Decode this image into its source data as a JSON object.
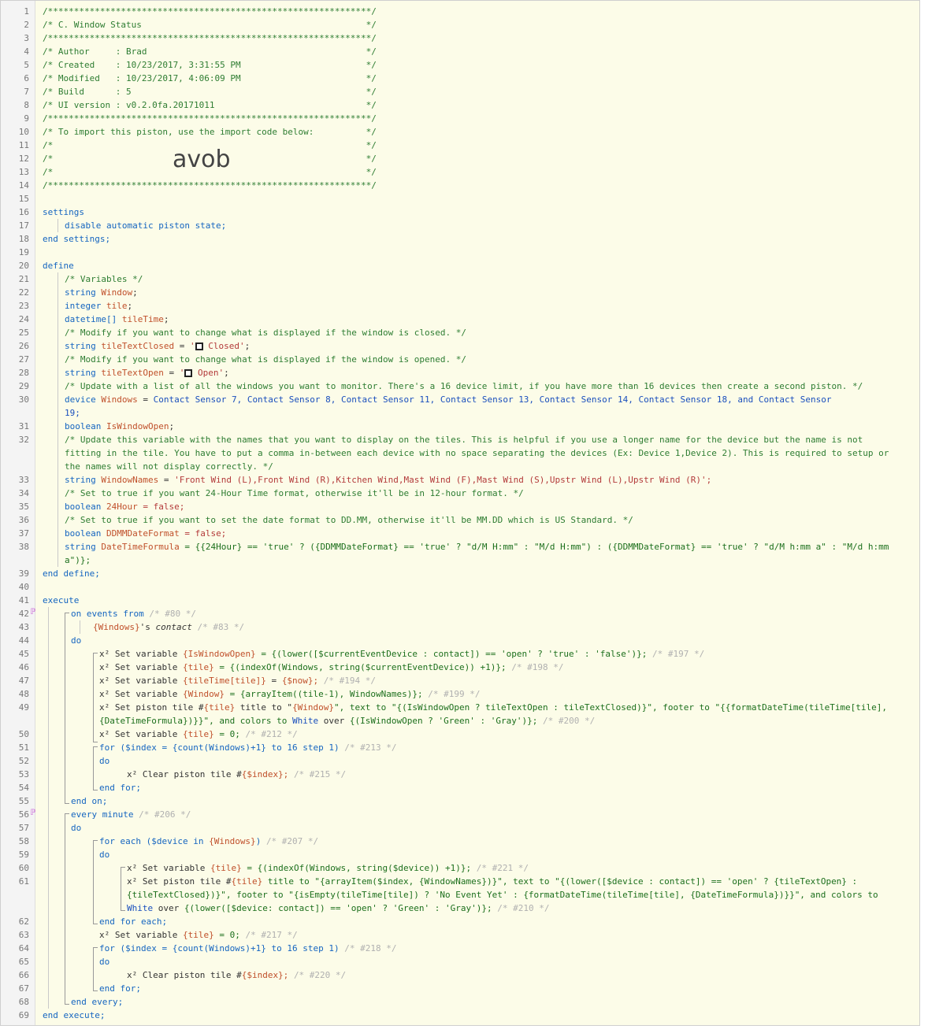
{
  "header": {
    "l1": "/**************************************************************/",
    "l2": "/* C. Window Status                                           */",
    "l3": "/**************************************************************/",
    "l4": "/* Author     : Brad                                          */",
    "l5": "/* Created    : 10/23/2017, 3:31:55 PM                        */",
    "l6": "/* Modified   : 10/23/2017, 4:06:09 PM                        */",
    "l7": "/* Build      : 5                                             */",
    "l8": "/* UI version : v0.2.0fa.20171011                             */",
    "l9": "/**************************************************************/",
    "l10": "/* To import this piston, use the import code below:          */",
    "l11": "/*                                                            */",
    "l12": "/*                                                            */",
    "l13": "/*                                                            */",
    "l14": "/**************************************************************/",
    "import_code": "avob"
  },
  "code": {
    "settings": "settings",
    "disable": "disable automatic piston state;",
    "end_settings": "end settings;",
    "define": "define",
    "vars_comment": "/* Variables */",
    "kw_string": "string",
    "kw_integer": "integer",
    "kw_datetime": "datetime[]",
    "kw_device": "device",
    "kw_boolean": "boolean",
    "var_window": "Window",
    "var_tile": "tile",
    "var_tiletime": "tileTime",
    "c25": "/* Modify if you want to change what is displayed if the window is closed. */",
    "var_closed": "tileTextClosed",
    "closed_val_a": "'",
    "closed_val_b": " Closed'",
    "c27": "/* Modify if you want to change what is displayed if the window is opened. */",
    "var_open": "tileTextOpen",
    "open_val_b": " Open'",
    "c29": "/* Update with a list of all the windows you want to monitor. There's a 16 device limit, if you have more than 16 devices then create a second piston. */",
    "var_windows": "Windows",
    "dev_list": "Contact Sensor 7, Contact Sensor 8, Contact Sensor 11, Contact Sensor 13, Contact Sensor 14, Contact Sensor 18, and Contact Sensor",
    "dev_list2": "19;",
    "var_iswo": "IsWindowOpen",
    "c32a": "/* Update this variable with the names that you want to display on the tiles. This is helpful if you use a longer name for the device but the name is not",
    "c32b": "fitting in the tile. You have to put a comma in-between each device with no space separating the devices (Ex: Device 1,Device 2). This is required to setup or",
    "c32c": "the names will not display correctly. */",
    "var_wn": "WindowNames",
    "wn_val": "'Front Wind (L),Front Wind (R),Kitchen Wind,Mast Wind (F),Mast Wind (S),Upstr Wind (L),Upstr Wind (R)';",
    "c34": "/* Set to true if you want 24-Hour Time format, otherwise it'll be in 12-hour format. */",
    "var_24": "24Hour",
    "false_val": "= false;",
    "c36": "/* Set to true if you want to set the date format to DD.MM, otherwise it'll be MM.DD which is US Standard. */",
    "var_dd": "DDMMDateFormat",
    "var_dtf": "DateTimeFormula",
    "dtf_val": "= {{24Hour} == 'true' ? ({DDMMDateFormat} == 'true' ? \"d/M H:mm\" : \"M/d H:mm\") : ({DDMMDateFormat} == 'true' ? \"d/M h:mm a\" : \"M/d h:mm",
    "dtf_val2": "a\")};",
    "end_define": "end define;",
    "execute": "execute",
    "on_events": "on events from",
    "m80": "/* #80 */",
    "windows_ref": "{Windows}",
    "s_contact": "'s",
    "contact": "contact",
    "m83": "/* #83 */",
    "do": "do",
    "setvar": "x² Set variable",
    "l45": "= {(lower([$currentEventDevice : contact]) == 'open' ? 'true' : 'false')};",
    "m197": "/* #197 */",
    "tile_ref": "{tile}",
    "l46": "= {(indexOf(Windows, string($currentEventDevice)) +1)};",
    "m198": "/* #198 */",
    "tiletime_ref": "{tileTime[tile]}",
    "now_ref": "{$now};",
    "m194": "/* #194 */",
    "window_ref": "{Window}",
    "l48": "= {arrayItem((tile-1), WindowNames)};",
    "m199": "/* #199 */",
    "iswo_ref": "{IsWindowOpen}",
    "settile": "x² Set piston tile #",
    "l49a": "title to \"",
    "l49b": "\", text to \"{(IsWindowOpen ? tileTextOpen : tileTextClosed)}\", footer to \"{{formatDateTime(tileTime[tile],",
    "l49c": "{DateTimeFormula})}}\", and colors to",
    "white": "White",
    "over": "over",
    "l49d": "{(IsWindowOpen ? 'Green' : 'Gray')};",
    "m200": "/* #200 */",
    "zero": "= 0;",
    "m212": "/* #212 */",
    "for_index": "for ($index = {count(Windows)+1} to 16 step 1)",
    "m213": "/* #213 */",
    "clear_tile": "x² Clear piston tile #",
    "index_ref": "{$index};",
    "m215": "/* #215 */",
    "end_for": "end for;",
    "end_on": "end on;",
    "every_minute": "every minute",
    "m206": "/* #206 */",
    "for_each": "for each ($device in",
    "m207": "/* #207 */",
    "l60": "= {(indexOf(Windows, string($device)) +1)};",
    "m221": "/* #221 */",
    "l61a": "title to \"{arrayItem($index, {WindowNames})}\", text to \"{(lower([$device : contact]) == 'open' ? {tileTextOpen} :",
    "l61b": "{tileTextClosed})}\", footer to \"{isEmpty(tileTime[tile]) ? 'No Event Yet' : {formatDateTime(tileTime[tile], {DateTimeFormula})}}\", and colors to",
    "l61c": "{(lower([$device: contact]) == 'open' ? 'Green' : 'Gray')};",
    "m210": "/* #210 */",
    "end_for_each": "end for each;",
    "m217": "/* #217 */",
    "m218": "/* #218 */",
    "m220": "/* #220 */",
    "end_every": "end every;",
    "end_execute": "end execute;"
  },
  "line_numbers": [
    "1",
    "2",
    "3",
    "4",
    "5",
    "6",
    "7",
    "8",
    "9",
    "10",
    "11",
    "12",
    "13",
    "14",
    "15",
    "16",
    "17",
    "18",
    "19",
    "20",
    "21",
    "22",
    "23",
    "24",
    "25",
    "26",
    "27",
    "28",
    "29",
    "30",
    "31",
    "32",
    "33",
    "34",
    "35",
    "36",
    "37",
    "38",
    "39",
    "40",
    "41",
    "42",
    "43",
    "44",
    "45",
    "46",
    "47",
    "48",
    "49",
    "50",
    "51",
    "52",
    "53",
    "54",
    "55",
    "56",
    "57",
    "58",
    "59",
    "60",
    "61",
    "62",
    "63",
    "64",
    "65",
    "66",
    "67",
    "68",
    "69"
  ],
  "icons": {
    "condition_marker": "ℙ",
    "checkbox": "black-square-icon"
  },
  "colors": {
    "background": "#fcfce8",
    "comment": "#2e7d32",
    "keyword": "#1565c0",
    "variable": "#c0502b",
    "string": "#b33a3a",
    "expression": "#1c6f1c"
  }
}
